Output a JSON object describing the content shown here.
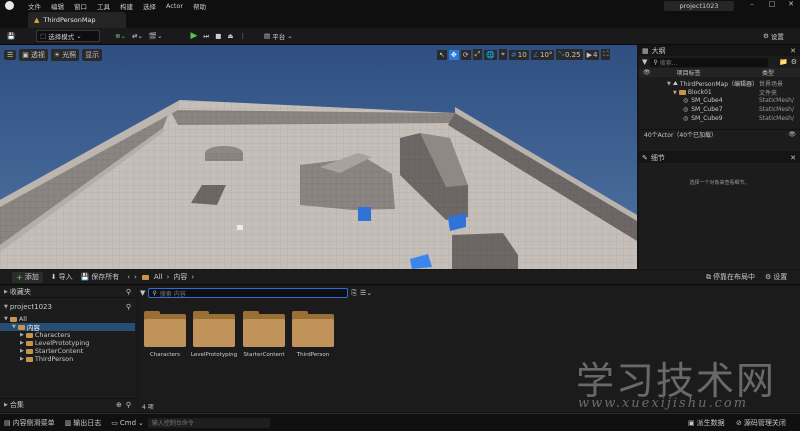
{
  "titlebar": {
    "menus": [
      "文件",
      "编辑",
      "窗口",
      "工具",
      "构建",
      "选择",
      "Actor",
      "帮助"
    ],
    "project": "project1023"
  },
  "tabs": {
    "map": "ThirdPersonMap"
  },
  "toolbar": {
    "mode": "选择模式",
    "platform": "平台",
    "settings": "设置"
  },
  "viewport": {
    "perspective": "透视",
    "lit": "光照",
    "show": "显示",
    "grid_snap": "10",
    "rot_snap": "10°",
    "scale_snap": "0.25",
    "cam_speed": "4"
  },
  "outliner": {
    "title": "大纲",
    "search_placeholder": "搜索...",
    "col_label": "项目标签",
    "col_type": "类型",
    "rows": [
      {
        "label": "ThirdPersonMap（编辑器）",
        "type": "世界场景"
      },
      {
        "label": "Block01",
        "type": "文件夹"
      },
      {
        "label": "SM_Cube4",
        "type": "StaticMesh/"
      },
      {
        "label": "SM_Cube7",
        "type": "StaticMesh/"
      },
      {
        "label": "SM_Cube9",
        "type": "StaticMesh/"
      }
    ],
    "count": "40个Actor（40个已加载）"
  },
  "details": {
    "title": "细节",
    "empty": "选择一个对象来查看细节。"
  },
  "content_browser": {
    "add": "添加",
    "import": "导入",
    "save_all": "保存所有",
    "path": [
      "All",
      "内容"
    ],
    "dock": "停靠在布局中",
    "settings": "设置",
    "favorites": "收藏夹",
    "project": "project1023",
    "search_placeholder": "搜索 内容",
    "tree": [
      "All",
      "内容",
      "Characters",
      "LevelPrototyping",
      "StarterContent",
      "ThirdPerson"
    ],
    "folders": [
      "Characters",
      "LevelPrototyping",
      "StarterContent",
      "ThirdPerson"
    ],
    "collections": "合集",
    "item_count": "4 项"
  },
  "statusbar": {
    "drawer": "内容侧滑菜单",
    "output_log": "输出日志",
    "cmd": "Cmd",
    "console_placeholder": "输入控制台命令",
    "derived": "派生数据",
    "source_control": "源码管理关闭"
  },
  "watermark": {
    "cn": "学习技术网",
    "url": "www.xuexijishu.com"
  }
}
